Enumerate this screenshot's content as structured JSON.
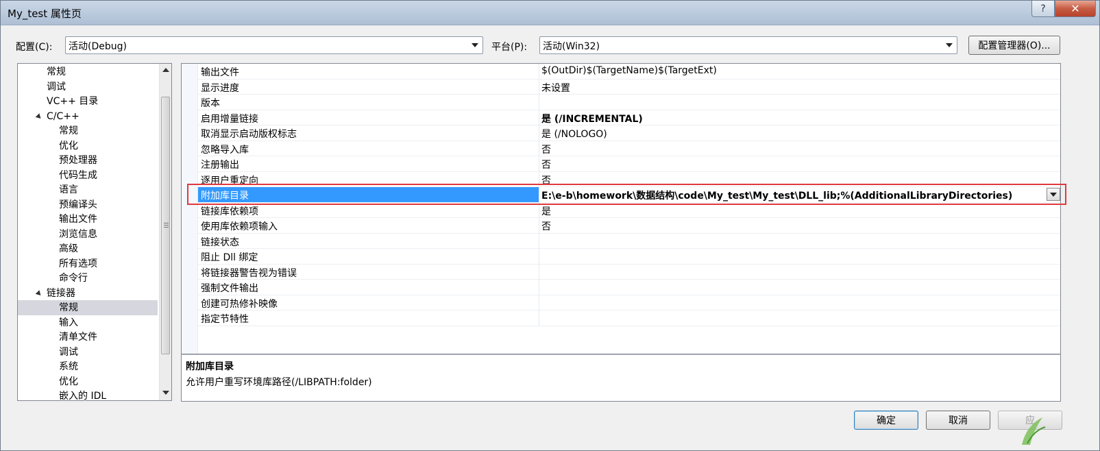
{
  "window": {
    "title": "My_test 属性页",
    "help_label": "?",
    "close_label": "✕"
  },
  "config": {
    "label": "配置(C):",
    "value": "活动(Debug)"
  },
  "platform": {
    "label": "平台(P):",
    "value": "活动(Win32)"
  },
  "config_manager_label": "配置管理器(O)...",
  "tree": {
    "items": [
      {
        "label": "常规",
        "level": 1
      },
      {
        "label": "调试",
        "level": 1
      },
      {
        "label": "VC++ 目录",
        "level": 1
      },
      {
        "label": "C/C++",
        "level": 0,
        "expanded": true
      },
      {
        "label": "常规",
        "level": 2
      },
      {
        "label": "优化",
        "level": 2
      },
      {
        "label": "预处理器",
        "level": 2
      },
      {
        "label": "代码生成",
        "level": 2
      },
      {
        "label": "语言",
        "level": 2
      },
      {
        "label": "预编译头",
        "level": 2
      },
      {
        "label": "输出文件",
        "level": 2
      },
      {
        "label": "浏览信息",
        "level": 2
      },
      {
        "label": "高级",
        "level": 2
      },
      {
        "label": "所有选项",
        "level": 2
      },
      {
        "label": "命令行",
        "level": 2
      },
      {
        "label": "链接器",
        "level": 0,
        "expanded": true
      },
      {
        "label": "常规",
        "level": 2,
        "selected": true
      },
      {
        "label": "输入",
        "level": 2
      },
      {
        "label": "清单文件",
        "level": 2
      },
      {
        "label": "调试",
        "level": 2
      },
      {
        "label": "系统",
        "level": 2
      },
      {
        "label": "优化",
        "level": 2
      },
      {
        "label": "嵌入的 IDL",
        "level": 2
      }
    ]
  },
  "properties": {
    "rows": [
      {
        "name": "输出文件",
        "value": "$(OutDir)$(TargetName)$(TargetExt)"
      },
      {
        "name": "显示进度",
        "value": "未设置"
      },
      {
        "name": "版本",
        "value": ""
      },
      {
        "name": "启用增量链接",
        "value": "是 (/INCREMENTAL)",
        "bold": true
      },
      {
        "name": "取消显示启动版权标志",
        "value": "是 (/NOLOGO)"
      },
      {
        "name": "忽略导入库",
        "value": "否"
      },
      {
        "name": "注册输出",
        "value": "否"
      },
      {
        "name": "逐用户重定向",
        "value": "否"
      },
      {
        "name": "附加库目录",
        "value": "E:\\e-b\\homework\\数据结构\\code\\My_test\\My_test\\DLL_lib;%(AdditionalLibraryDirectories)",
        "bold": true,
        "selected": true
      },
      {
        "name": "链接库依赖项",
        "value": "是"
      },
      {
        "name": "使用库依赖项输入",
        "value": "否"
      },
      {
        "name": "链接状态",
        "value": ""
      },
      {
        "name": "阻止 Dll 绑定",
        "value": ""
      },
      {
        "name": "将链接器警告视为错误",
        "value": ""
      },
      {
        "name": "强制文件输出",
        "value": ""
      },
      {
        "name": "创建可热修补映像",
        "value": ""
      },
      {
        "name": "指定节特性",
        "value": ""
      }
    ]
  },
  "description": {
    "title": "附加库目录",
    "text": "允许用户重写环境库路径(/LIBPATH:folder)"
  },
  "buttons": {
    "ok": "确定",
    "cancel": "取消",
    "apply": "应"
  }
}
